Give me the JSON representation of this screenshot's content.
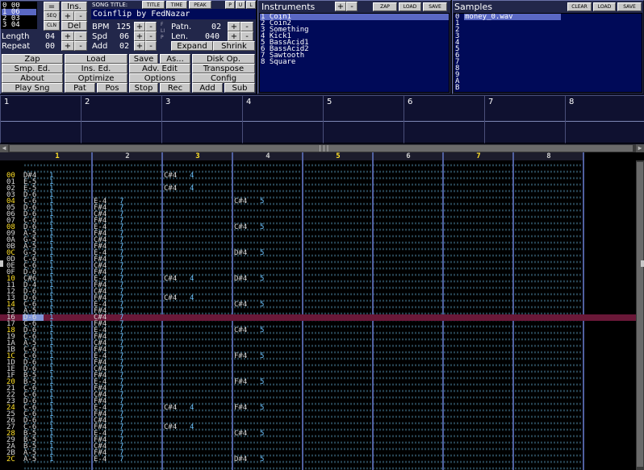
{
  "sequence": {
    "rows": [
      "0 00",
      "1 06",
      "2 03",
      "3 04"
    ]
  },
  "top_buttons": {
    "ins": "Ins.",
    "del": "Del",
    "plus": "+",
    "minus": "-",
    "seq": "SEQ",
    "cln": "CLN",
    "eq": "="
  },
  "song": {
    "title_label": "SONG TITLE:",
    "title_tab": "TITLE",
    "time_tab": "TIME",
    "peak_tab": "PEAK",
    "title": "Coinflip by FedNazar",
    "p": "P",
    "u": "U",
    "l": "L"
  },
  "params": {
    "length_label": "Length",
    "length_val": "04",
    "repeat_label": "Repeat",
    "repeat_val": "00",
    "bpm_label": "BPM",
    "bpm_val": "125",
    "spd_label": "Spd",
    "spd_val": "06",
    "add_label": "Add",
    "add_val": "02",
    "patn_label": "Patn.",
    "patn_val": "02",
    "len_label": "Len.",
    "len_val": "040",
    "expand": "Expand",
    "shrink": "Shrink",
    "flip": "FLIP"
  },
  "main_buttons": [
    [
      "Zap",
      "Load",
      "Save",
      "As...",
      "Disk Op."
    ],
    [
      "Smp. Ed.",
      "Ins. Ed.",
      "Adv. Edit",
      "Transpose"
    ],
    [
      "About",
      "Optimize",
      "Options",
      "Config"
    ],
    [
      "Play Sng",
      "Pat",
      "Pos",
      "Stop",
      "Rec",
      "Add",
      "Sub"
    ]
  ],
  "instruments": {
    "title": "Instruments",
    "zap": "ZAP",
    "load": "LOAD",
    "save": "SAVE",
    "items": [
      "1 Coin1",
      "2 Coin2",
      "3 Something",
      "4 Kick1",
      "5 BassAcid1",
      "6 BassAcid2",
      "7 Sawtooth",
      "8 Square"
    ]
  },
  "samples": {
    "title": "Samples",
    "clear": "CLEAR",
    "load": "LOAD",
    "save": "SAVE",
    "numbers": [
      "0",
      "1",
      "2",
      "3",
      "4",
      "5",
      "6",
      "7",
      "8",
      "9",
      "A",
      "B"
    ],
    "items": [
      "money_0.wav"
    ]
  },
  "scopes": [
    "1",
    "2",
    "3",
    "4",
    "5",
    "6",
    "7",
    "8"
  ],
  "channels": [
    "1",
    "2",
    "3",
    "4",
    "5",
    "6",
    "7",
    "8"
  ],
  "pattern": {
    "rows": [
      "00",
      "01",
      "02",
      "03",
      "04",
      "05",
      "06",
      "07",
      "08",
      "09",
      "0A",
      "0B",
      "0C",
      "0D",
      "0E",
      "0F",
      "10",
      "11",
      "12",
      "13",
      "14",
      "15",
      "16",
      "17",
      "18",
      "19",
      "1A",
      "1B",
      "1C",
      "1D",
      "1E",
      "1F",
      "20",
      "21",
      "22",
      "23",
      "24",
      "25",
      "26",
      "27",
      "28",
      "29",
      "2A",
      "2B",
      "2C"
    ],
    "ch1": [
      "D#4",
      "E-5",
      "E-5",
      "D-6",
      "C-6",
      "D-6",
      "D-6",
      "C-6",
      "D-6",
      "A-5",
      "G-5",
      "A-5",
      "G-5",
      "C-6",
      "C-6",
      "D-6",
      "C#6",
      "D-4",
      "D-6",
      "D-6",
      "C-6",
      "A-5",
      "D-6",
      "C-6",
      "D-6",
      "C-6",
      "A-5",
      "C-6",
      "C-6",
      "D-6",
      "D-6",
      "B-5",
      "B-5",
      "C-6",
      "C-6",
      "D-6",
      "C-6",
      "C-6",
      "D-6",
      "C-6",
      "B-5",
      "B-5",
      "B-5",
      "A-5",
      "A-5"
    ],
    "ch2": [
      "",
      "",
      "",
      "",
      "E-4",
      "F#4",
      "C#4",
      "F#4",
      "E-4",
      "F#4",
      "C#4",
      "F#4",
      "E-4",
      "F#4",
      "C#4",
      "F#4",
      "E-4",
      "F#4",
      "C#4",
      "F#4",
      "E-4",
      "F#4",
      "C#4",
      "F#4",
      "E-4",
      "F#4",
      "C#4",
      "F#4",
      "E-4",
      "F#4",
      "C#4",
      "F#4",
      "E-4",
      "F#4",
      "C#4",
      "F#4",
      "E-4",
      "F#4",
      "C#4",
      "F#4",
      "E-4",
      "F#4",
      "C#4",
      "F#4",
      "E-4"
    ],
    "ch3": [
      "C#4",
      "",
      "C#4",
      "",
      "",
      "",
      "",
      "",
      "",
      "",
      "",
      "",
      "",
      "",
      "",
      "",
      "C#4",
      "",
      "",
      "C#4",
      "",
      "",
      "",
      "",
      "",
      "",
      "",
      "",
      "",
      "",
      "",
      "",
      "",
      "",
      "",
      "",
      "C#4",
      "",
      "",
      "C#4",
      "",
      "",
      "",
      "",
      ""
    ],
    "ch4": [
      "",
      "",
      "",
      "",
      "C#4",
      "",
      "",
      "",
      "C#4",
      "",
      "",
      "",
      "D#4",
      "",
      "",
      "",
      "D#4",
      "",
      "",
      "",
      "C#4",
      "",
      "",
      "",
      "C#4",
      "",
      "",
      "",
      "F#4",
      "",
      "",
      "",
      "F#4",
      "",
      "",
      "",
      "F#4",
      "",
      "",
      "",
      "C#4",
      "",
      "",
      "",
      "D#4"
    ],
    "ins1": "1",
    "ins2": "7",
    "ins3": "4",
    "ins4": "5",
    "current_row": 22
  }
}
